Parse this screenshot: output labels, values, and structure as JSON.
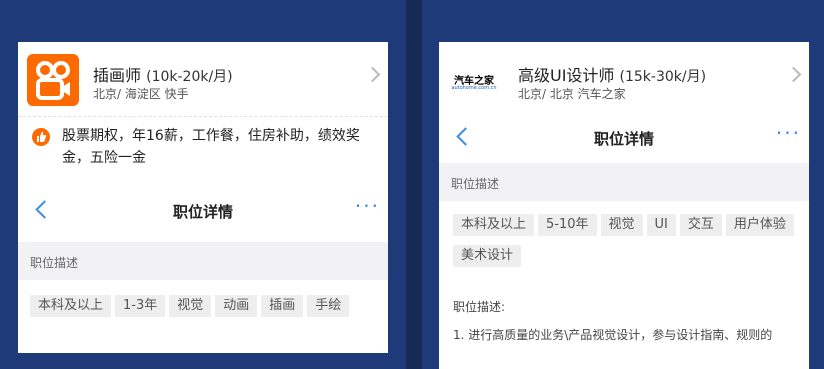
{
  "left": {
    "title": "插画师",
    "salary": "(10k-20k/月)",
    "meta": "北京/ 海淀区  快手",
    "benefits": "股票期权，年16薪，工作餐，住房补助，绩效奖金，五险一金",
    "nav_title": "职位详情",
    "section": "职位描述",
    "tags": [
      "本科及以上",
      "1-3年",
      "视觉",
      "动画",
      "插画",
      "手绘"
    ]
  },
  "right": {
    "logo_text": "汽车之家",
    "logo_sub": "autohome.com.cn",
    "title": "高级UI设计师",
    "salary": "(15k-30k/月)",
    "meta": "北京/ 北京  汽车之家",
    "nav_title": "职位详情",
    "section": "职位描述",
    "tags": [
      "本科及以上",
      "5-10年",
      "视觉",
      "UI",
      "交互",
      "用户体验",
      "美术设计"
    ],
    "desc_head": "职位描述:",
    "desc_line": "1. 进行高质量的业务\\产品视觉设计，参与设计指南、规则的"
  },
  "icons": {
    "more": "···"
  }
}
